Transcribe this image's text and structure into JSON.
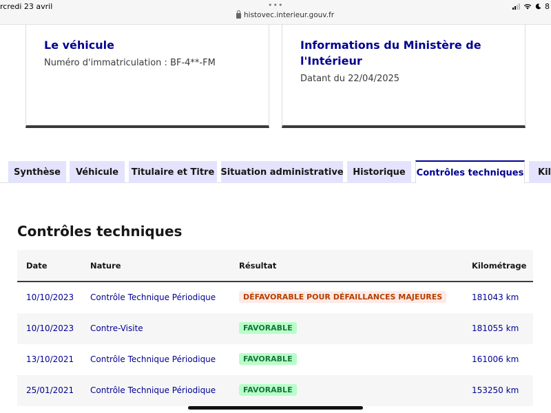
{
  "statusbar": {
    "time": "rcredi 23 avril",
    "dots": "•••",
    "url": "histovec.interieur.gouv.fr",
    "battery": "8"
  },
  "cards": {
    "vehicle": {
      "title": "Le véhicule",
      "plate": "Numéro d'immatriculation : BF-4**-FM"
    },
    "ministry": {
      "title": "Informations du Ministère de l'Intérieur",
      "date": "Datant du 22/04/2025"
    }
  },
  "tabs": [
    {
      "label": "Synthèse"
    },
    {
      "label": "Véhicule"
    },
    {
      "label": "Titulaire et Titre"
    },
    {
      "label": "Situation administrative"
    },
    {
      "label": "Historique"
    },
    {
      "label": "Contrôles techniques"
    },
    {
      "label": "Kilo"
    }
  ],
  "active_tab": "Contrôles techniques",
  "section": {
    "title": "Contrôles techniques",
    "columns": {
      "date": "Date",
      "nature": "Nature",
      "result": "Résultat",
      "km": "Kilométrage"
    },
    "rows": [
      {
        "date": "10/10/2023",
        "nature": "Contrôle Technique Périodique",
        "result": "DÉFAVORABLE POUR DÉFAILLANCES MAJEURES",
        "status": "fail",
        "km": "181043 km"
      },
      {
        "date": "10/10/2023",
        "nature": "Contre-Visite",
        "result": "FAVORABLE",
        "status": "ok",
        "km": "181055 km"
      },
      {
        "date": "13/10/2021",
        "nature": "Contrôle Technique Périodique",
        "result": "FAVORABLE",
        "status": "ok",
        "km": "161006 km"
      },
      {
        "date": "25/01/2021",
        "nature": "Contrôle Technique Périodique",
        "result": "FAVORABLE",
        "status": "ok",
        "km": "153250 km"
      }
    ]
  },
  "colors": {
    "accent": "#000091",
    "tab_bg": "#e3e3fd",
    "fail_bg": "#fee9e5",
    "fail_fg": "#b34000",
    "ok_bg": "#b8fec9",
    "ok_fg": "#18753c"
  }
}
